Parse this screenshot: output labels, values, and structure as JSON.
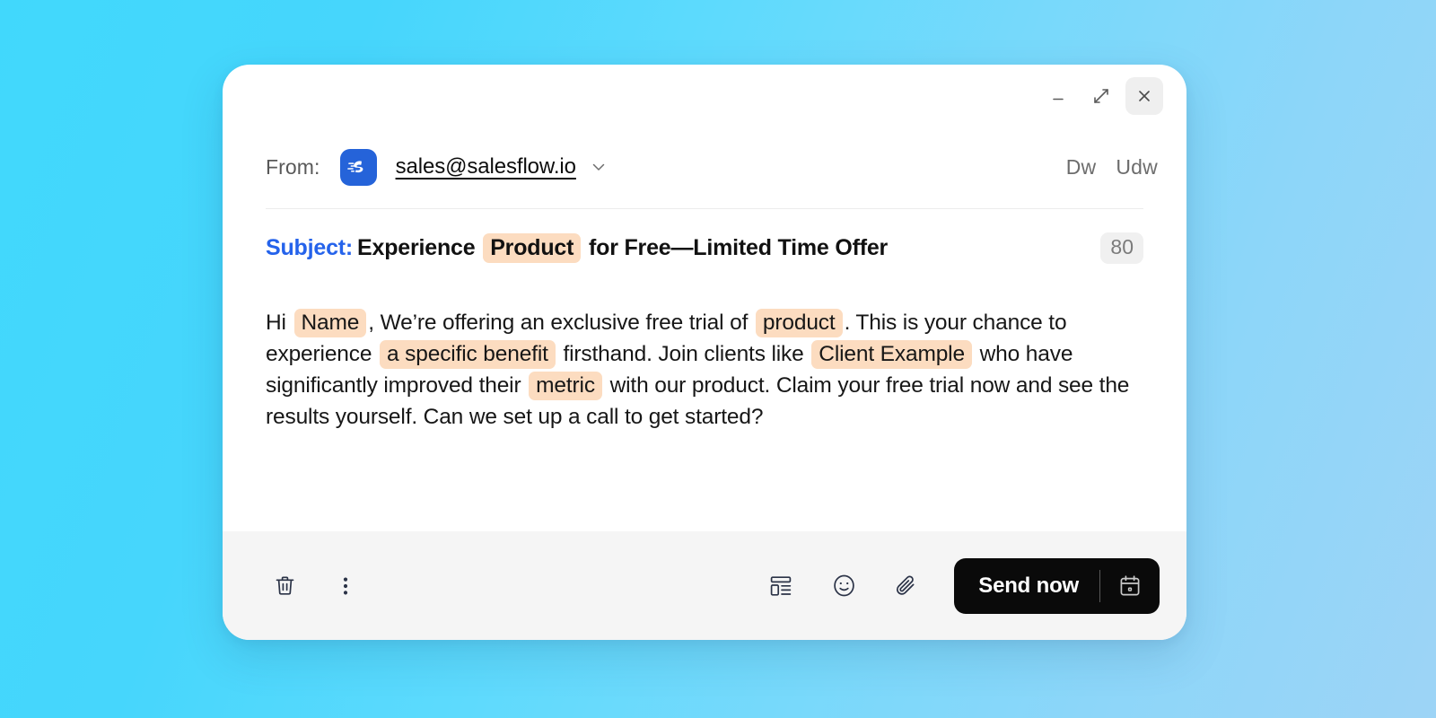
{
  "window": {
    "controls": {
      "minimize_label": "Minimize",
      "expand_label": "Expand",
      "close_label": "Close"
    }
  },
  "from": {
    "label": "From:",
    "logo_icon": "salesflow-logo-icon",
    "email": "sales@salesflow.io",
    "dropdown_icon": "chevron-down-icon",
    "actions": [
      {
        "label": "Dw"
      },
      {
        "label": "Udw"
      }
    ]
  },
  "subject": {
    "label": "Subject:",
    "text_before": "Experience",
    "variable": "Product",
    "text_after": "for Free—Limited Time Offer",
    "char_count": "80"
  },
  "body": {
    "segments": [
      {
        "type": "text",
        "value": "Hi "
      },
      {
        "type": "chip",
        "value": "Name"
      },
      {
        "type": "text",
        "value": ", We’re offering an exclusive free trial of "
      },
      {
        "type": "chip",
        "value": "product"
      },
      {
        "type": "text",
        "value": ". This is your chance to experience "
      },
      {
        "type": "chip",
        "value": "a specific benefit"
      },
      {
        "type": "text",
        "value": " firsthand. Join clients like "
      },
      {
        "type": "chip",
        "value": "Client Example"
      },
      {
        "type": "text",
        "value": " who have significantly improved their "
      },
      {
        "type": "chip",
        "value": "metric"
      },
      {
        "type": "text",
        "value": " with our product. Claim your free trial now and see the results yourself. Can we set up a call to get started?"
      }
    ]
  },
  "toolbar": {
    "delete_icon": "trash-icon",
    "more_icon": "more-vertical-icon",
    "format_icon": "layout-template-icon",
    "emoji_icon": "smiley-icon",
    "attach_icon": "paperclip-icon",
    "send_label": "Send now",
    "schedule_icon": "calendar-icon"
  },
  "colors": {
    "background_start": "#41d8fc",
    "background_end": "#9dd4f6",
    "card": "#ffffff",
    "accent_blue": "#2563eb",
    "logo_blue": "#2563d9",
    "chip_highlight": "#fcdcc0",
    "send_button": "#0a0a0a",
    "footer": "#f5f5f5",
    "icon_stroke": "#2b3347"
  }
}
